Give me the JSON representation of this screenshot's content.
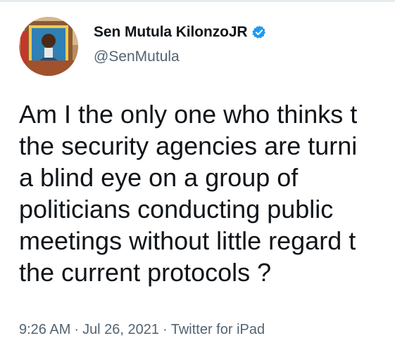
{
  "author": {
    "display_name": "Sen Mutula KilonzoJR",
    "handle": "@SenMutula",
    "verified": true,
    "verified_color": "#1d9bf0"
  },
  "tweet": {
    "lines": [
      "Am I the only one who thinks t",
      "the security agencies are turni",
      "a blind eye on a group of",
      "politicians conducting public",
      "meetings without little regard t",
      "the current protocols ?"
    ]
  },
  "meta": {
    "time": "9:26 AM",
    "separator": "·",
    "date": "Jul 26, 2021",
    "source": "Twitter for iPad"
  }
}
